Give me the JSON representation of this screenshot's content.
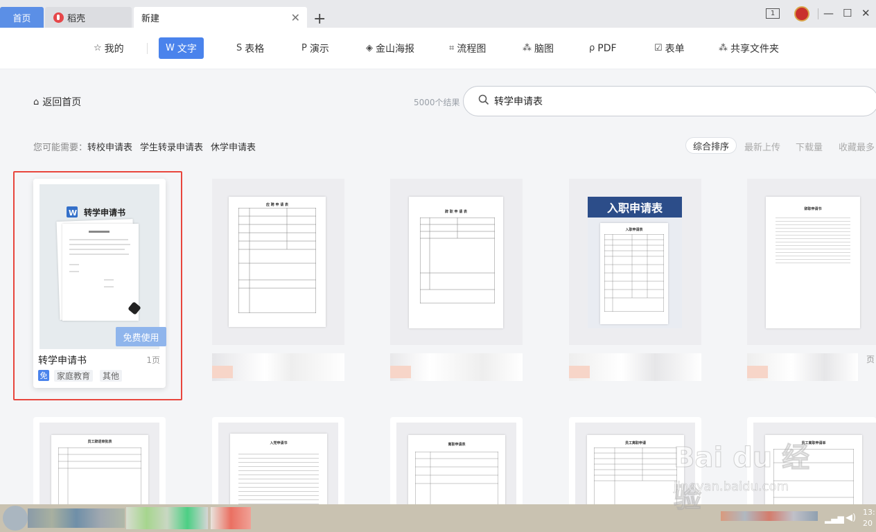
{
  "tabs": {
    "home": "首页",
    "daoke": "稻壳",
    "new": "新建"
  },
  "categories": [
    {
      "label": "我的",
      "icon": "star-icon",
      "glyph": "☆"
    },
    {
      "label": "文字",
      "icon": "word-icon",
      "glyph": "W",
      "active": true
    },
    {
      "label": "表格",
      "icon": "sheet-icon",
      "glyph": "S"
    },
    {
      "label": "演示",
      "icon": "presentation-icon",
      "glyph": "P"
    },
    {
      "label": "金山海报",
      "icon": "poster-icon",
      "glyph": "◈"
    },
    {
      "label": "流程图",
      "icon": "flowchart-icon",
      "glyph": "⌗"
    },
    {
      "label": "脑图",
      "icon": "mindmap-icon",
      "glyph": "⁂"
    },
    {
      "label": "PDF",
      "icon": "pdf-icon",
      "glyph": "ρ"
    },
    {
      "label": "表单",
      "icon": "form-icon",
      "glyph": "☑"
    },
    {
      "label": "共享文件夹",
      "icon": "shared-folder-icon",
      "glyph": "⁂"
    }
  ],
  "toolbar": {
    "back_label": "返回首页",
    "result_count": "5000个结果",
    "search_value": "转学申请表"
  },
  "suggest": {
    "label": "您可能需要：",
    "items": [
      "转校申请表",
      "学生转录申请表",
      "休学申请表"
    ]
  },
  "sort": {
    "all": "综合排序",
    "newest": "最新上传",
    "downloads": "下载量",
    "favorites": "收藏最多"
  },
  "card1": {
    "thumb_title": "转学申请书",
    "free_button": "免费使用",
    "title": "转学申请书",
    "pages": "1页",
    "free_badge": "免",
    "tags": [
      "家庭教育",
      "其他"
    ]
  },
  "card2": {
    "thumb_title": "应 聘 申 请 表"
  },
  "card3": {
    "thumb_title": "辞 职 申 请 表"
  },
  "card4": {
    "banner": "入职申请表",
    "thumb_title": "入职申请表"
  },
  "card5": {
    "thumb_title": "辞职申请书",
    "pages_partial": "页"
  },
  "row2": {
    "t1": "员工辞退审批表",
    "t2": "入党申请书",
    "t3": "离职申请表",
    "t4": "员工离职申请",
    "t5": "员工离职申请单"
  },
  "watermark": {
    "big": "Bai du 经验",
    "small": "jingyan.baidu.com"
  },
  "clock": {
    "time": "13:",
    "date": "20"
  },
  "colors": {
    "accent": "#4a83ec",
    "highlight": "#e8453c",
    "tab_active": "#5b8fe6"
  }
}
